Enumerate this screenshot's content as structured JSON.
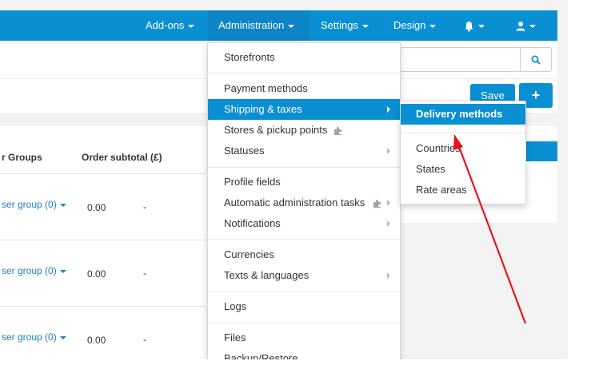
{
  "nav": {
    "addons": "Add-ons",
    "administration": "Administration",
    "settings": "Settings",
    "design": "Design"
  },
  "toolbar": {
    "save_label": "Save",
    "add_label": "+"
  },
  "table": {
    "columns": [
      "r Groups",
      "Order subtotal (£)"
    ],
    "rows": [
      {
        "group": "ser group (0)",
        "subtotal": "0.00",
        "extra": "-"
      },
      {
        "group": "ser group (0)",
        "subtotal": "0.00",
        "extra": "-"
      },
      {
        "group": "ser group (0)",
        "subtotal": "0.00",
        "extra": "-"
      }
    ]
  },
  "admin_menu": {
    "items": [
      "Storefronts",
      "Payment methods",
      "Shipping & taxes",
      "Stores & pickup points",
      "Statuses",
      "Profile fields",
      "Automatic administration tasks",
      "Notifications",
      "Currencies",
      "Texts & languages",
      "Logs",
      "Files",
      "Backup/Restore"
    ]
  },
  "shipping_submenu": {
    "items": [
      "Delivery methods",
      "Countries",
      "States",
      "Rate areas"
    ]
  },
  "colors": {
    "accent": "#0a8fd3",
    "annotation_arrow": "#e8141b"
  },
  "icons": [
    "bell-icon",
    "user-icon",
    "search-icon",
    "puzzle-icon"
  ]
}
